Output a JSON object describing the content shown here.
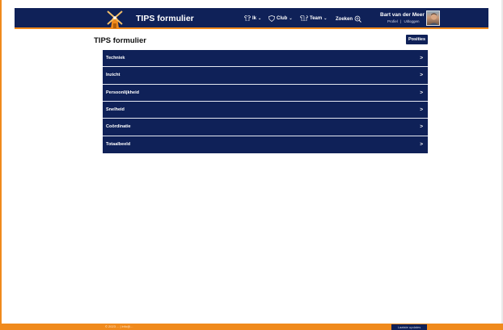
{
  "header": {
    "brand": "TIPS formulier",
    "nav": {
      "ik": "Ik",
      "club": "Club",
      "team": "Team",
      "zoeken": "Zoeken"
    },
    "user": {
      "name": "Bart van der Meer",
      "profiel": "Profiel",
      "separator": "|",
      "uitloggen": "Uitloggen"
    }
  },
  "page": {
    "title": "TIPS formulier",
    "posities_label": "Posities"
  },
  "list": {
    "items": [
      {
        "label": "Techniek"
      },
      {
        "label": "Inzicht"
      },
      {
        "label": "Persoonlijkheid"
      },
      {
        "label": "Snelheid"
      },
      {
        "label": "Coördinatie"
      },
      {
        "label": "Totaalbeeld"
      }
    ],
    "chevron": ">"
  },
  "footer": {
    "text": "© 2023 ... | info@...",
    "button_label": "Laatste updates"
  },
  "colors": {
    "primary": "#0f2158",
    "accent": "#f08a1c"
  }
}
